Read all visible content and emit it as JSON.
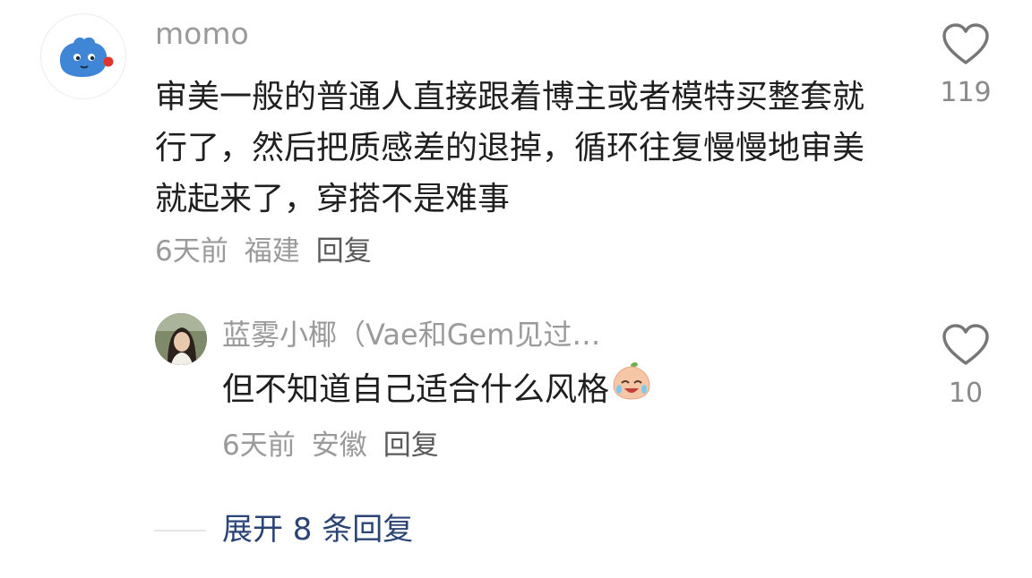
{
  "main_comment": {
    "username": "momo",
    "text": "审美一般的普通人直接跟着博主或者模特买整套就行了，然后把质感差的退掉，循环往复慢慢地审美就起来了，穿搭不是难事",
    "time": "6天前",
    "location": "福建",
    "reply_label": "回复",
    "like_count": "119",
    "avatar_icon": "blue-cartoon-creature-avatar"
  },
  "reply_comment": {
    "username": "蓝雾小椰（Vae和Gem见过…",
    "text": "但不知道自己适合什么风格",
    "emoji": "crying-laughing-peach-emoji",
    "time": "6天前",
    "location": "安徽",
    "reply_label": "回复",
    "like_count": "10",
    "avatar_icon": "woman-portrait-avatar"
  },
  "expand": {
    "label": "展开 8 条回复"
  },
  "colors": {
    "text_primary": "#1f1f1f",
    "text_secondary": "#9a9a9a",
    "link": "#2b4476",
    "heart": "#777777"
  }
}
